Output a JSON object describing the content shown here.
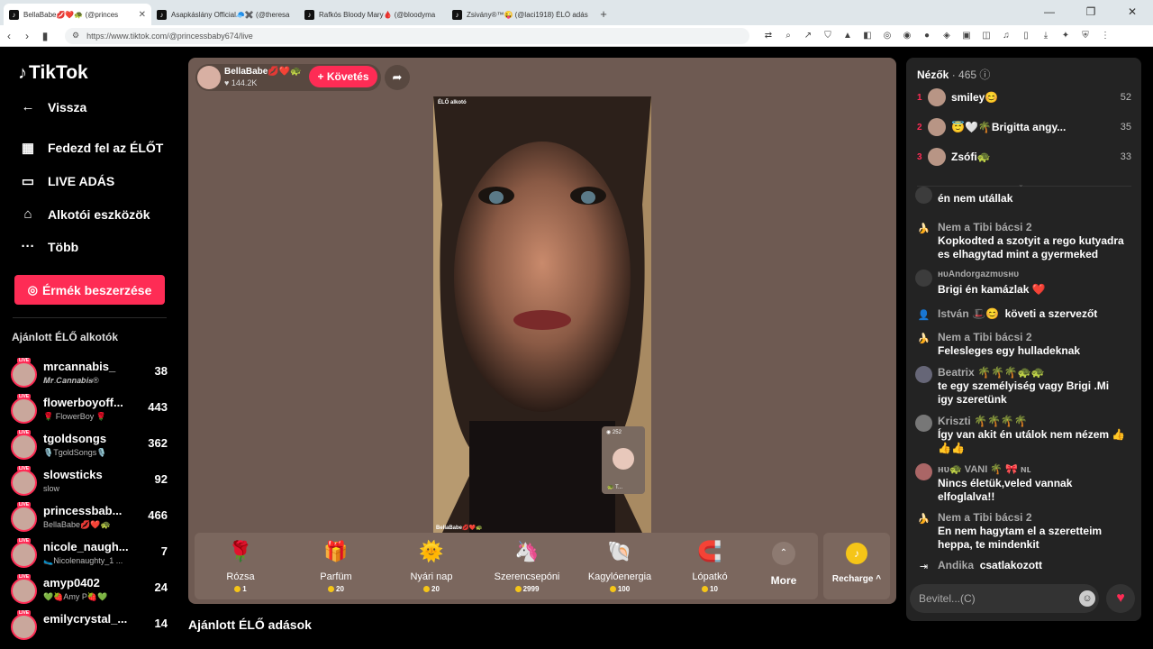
{
  "browser": {
    "tabs": [
      {
        "label": "BellaBabe💋❤️🐢 (@princes",
        "active": true
      },
      {
        "label": "Asapkáslány Official🧢✖️ (@theresa",
        "active": false
      },
      {
        "label": "Rafkós Bloody Mary🩸 (@bloodyma",
        "active": false
      },
      {
        "label": "Zsivány®™😜 (@laci1918) ÉLŐ adás",
        "active": false
      }
    ],
    "url": "https://www.tiktok.com/@princessbaby674/live"
  },
  "sidebar": {
    "logo": "TikTok",
    "menu": [
      {
        "label": "Vissza",
        "icon": "back-arrow-icon"
      },
      {
        "label": "Fedezd fel az ÉLŐT",
        "icon": "calendar-icon"
      },
      {
        "label": "LIVE ADÁS",
        "icon": "video-camera-icon"
      },
      {
        "label": "Alkotói eszközök",
        "icon": "creator-tools-icon"
      },
      {
        "label": "Több",
        "icon": "more-dots-icon"
      }
    ],
    "coins_button": "Érmék beszerzése",
    "recommended_title": "Ajánlott ÉLŐ alkotók",
    "creators": [
      {
        "name": "mrcannabis_",
        "sub": "𝑴𝒓.𝑪𝒂𝒏𝒏𝒂𝒃𝒊𝒔®",
        "count": "38"
      },
      {
        "name": "flowerboyoff...",
        "sub": "🌹 FlowerBoy 🌹",
        "count": "443"
      },
      {
        "name": "tgoldsongs",
        "sub": "🎙️TgoldSongs🎙️",
        "count": "362"
      },
      {
        "name": "slowsticks",
        "sub": "slow",
        "count": "92"
      },
      {
        "name": "princessbab...",
        "sub": "BellaBabe💋❤️🐢",
        "count": "466"
      },
      {
        "name": "nicole_naugh...",
        "sub": "🥿Nicolenaughty_1 ...",
        "count": "7"
      },
      {
        "name": "amyp0402",
        "sub": "💚🍓Amy P🍓💚",
        "count": "24"
      },
      {
        "name": "emilycrystal_...",
        "sub": "",
        "count": "14"
      }
    ],
    "live_badge": "LIVE"
  },
  "stage": {
    "host_name": "BellaBabe💋❤️🐢",
    "host_likes": "144.2K",
    "follow_label": "+ Követés",
    "video_tag": "ÉLŐ alkotó",
    "video_footer": "BellaBabe💋❤️🐢",
    "pip_viewers": "252",
    "pip_name": "🐢 T...",
    "gifts": [
      {
        "name": "Rózsa",
        "price": "1",
        "icon": "🌹"
      },
      {
        "name": "Parfüm",
        "price": "20",
        "icon": "🎁"
      },
      {
        "name": "Nyári nap",
        "price": "20",
        "icon": "🌞"
      },
      {
        "name": "Szerencsepóni",
        "price": "2999",
        "icon": "🦄"
      },
      {
        "name": "Kagylóenergia",
        "price": "100",
        "icon": "🐚"
      },
      {
        "name": "Lópatkó",
        "price": "10",
        "icon": "🧲"
      }
    ],
    "more_label": "More",
    "recharge_label": "Recharge ^",
    "recommended_live": "Ajánlott ÉLŐ adások"
  },
  "panel": {
    "viewers_title": "Nézők",
    "viewers_count": "· 465",
    "top_viewers": [
      {
        "rank": "1",
        "name": "smiley😊",
        "points": "52"
      },
      {
        "rank": "2",
        "name": "😇🤍🌴Brigitta angy...",
        "points": "35"
      },
      {
        "rank": "3",
        "name": "Zsófi🐢",
        "points": "33"
      }
    ],
    "messages": [
      {
        "type": "chat",
        "user": "",
        "text": "én nem utállak",
        "avatar": "user"
      },
      {
        "type": "chat",
        "user": "Nem a Tibi bácsi 2",
        "text": "Kopkodted a szotyit a rego kutyadra es elhagytad mint a gyermeked",
        "avatar": "banana"
      },
      {
        "type": "chat",
        "user": "ʜᴜAndorgazmᴜsʜᴜ",
        "text": "Brigi én kamázlak ❤️",
        "avatar": "user"
      },
      {
        "type": "info",
        "user": "István 🎩😊",
        "text": "követi a szervezőt",
        "avatar": "person"
      },
      {
        "type": "chat",
        "user": "Nem a Tibi bácsi 2",
        "text": "Felesleges egy hulladeknak",
        "avatar": "banana"
      },
      {
        "type": "chat",
        "user": "Beatrix 🌴🌴🌴🐢🐢",
        "text": "te egy személyiség vagy Brigi .Mi igy szeretünk",
        "avatar": "user"
      },
      {
        "type": "chat",
        "user": "Kriszti 🌴🌴🌴🌴",
        "text": "Így van akit én utálok nem nézem 👍👍👍",
        "avatar": "user"
      },
      {
        "type": "chat",
        "user": "ʜᴜ🐢 VANI 🌴 🎀 ɴʟ",
        "text": "Nincs életük,veled vannak elfoglalva!!",
        "avatar": "user"
      },
      {
        "type": "chat",
        "user": "Nem a Tibi bácsi 2",
        "text": "En nem hagytam el a szeretteim heppa, te mindenkit",
        "avatar": "banana"
      },
      {
        "type": "join",
        "user": "Andika",
        "text": "csatlakozott",
        "avatar": "enter"
      }
    ],
    "input_placeholder": "Bevitel...(C)"
  }
}
